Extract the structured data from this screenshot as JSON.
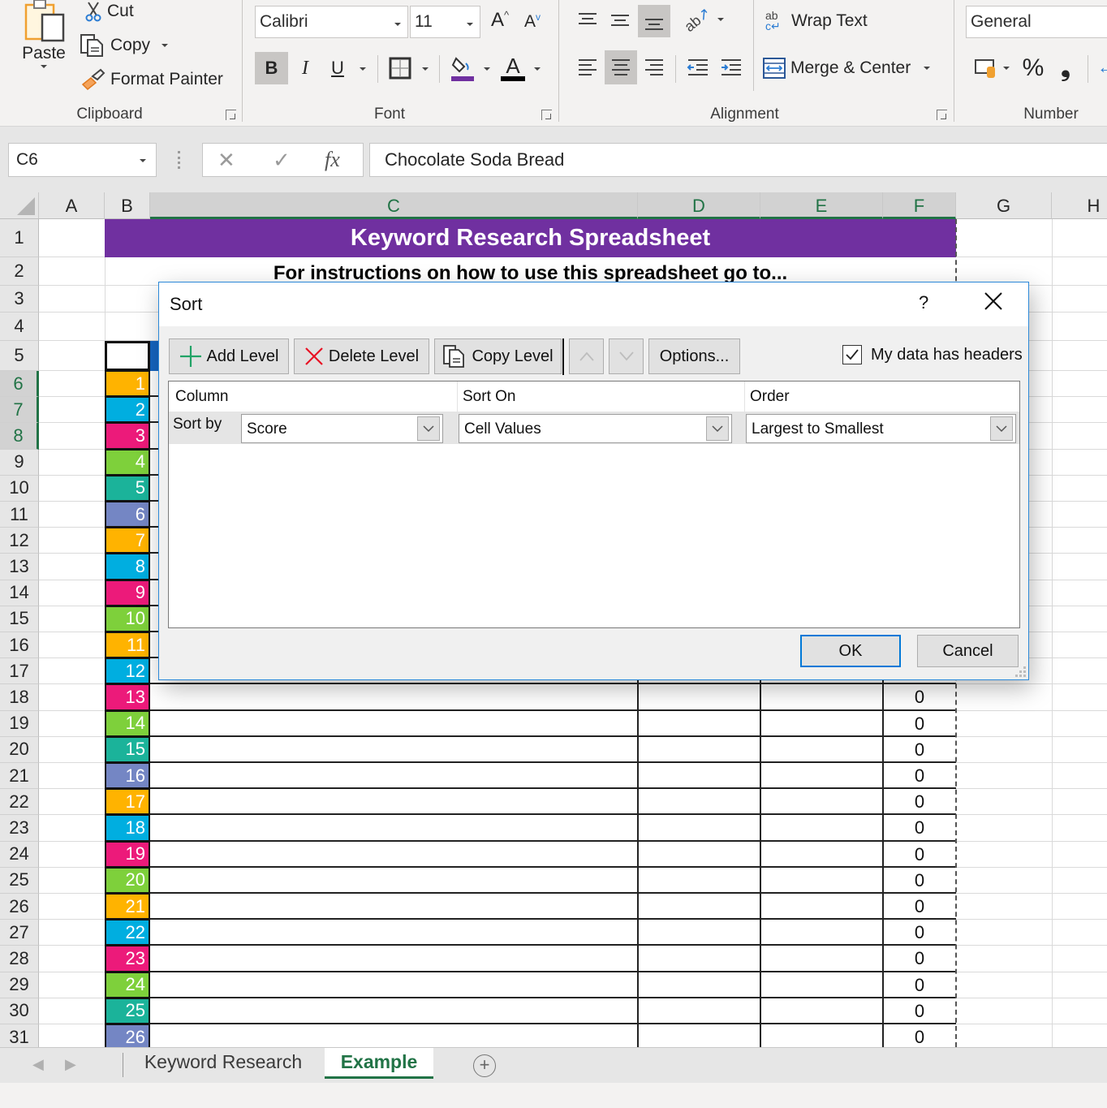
{
  "ribbon": {
    "clipboard": {
      "group_label": "Clipboard",
      "paste_label": "Paste",
      "cut_label": "Cut",
      "copy_label": "Copy",
      "format_painter_label": "Format Painter"
    },
    "font": {
      "group_label": "Font",
      "font_name": "Calibri",
      "font_size": "11",
      "bold_label": "B",
      "italic_label": "I",
      "underline_label": "U",
      "fill_color": "#7030a0",
      "font_color": "#000000"
    },
    "alignment": {
      "group_label": "Alignment",
      "wrap_text_label": "Wrap Text",
      "merge_center_label": "Merge & Center"
    },
    "number": {
      "group_label": "Number",
      "format": "General",
      "percent_label": "%",
      "comma_label": "9"
    }
  },
  "formula_bar": {
    "name_box": "C6",
    "fx_label": "fx",
    "formula": "Chocolate Soda Bread"
  },
  "sheet": {
    "columns": [
      "A",
      "B",
      "C",
      "D",
      "E",
      "F",
      "G",
      "H"
    ],
    "selected_column": "C",
    "rows": [
      "1",
      "2",
      "3",
      "4",
      "5",
      "6",
      "7",
      "8",
      "9",
      "10",
      "11",
      "12",
      "13",
      "14",
      "15",
      "16",
      "17",
      "18",
      "19",
      "20",
      "21",
      "22",
      "23",
      "24",
      "25",
      "26",
      "27",
      "28",
      "29",
      "30",
      "31"
    ],
    "selected_rows": [
      "6",
      "7",
      "8"
    ],
    "title": "Keyword Research Spreadsheet",
    "title_color": "#7030a0",
    "instructions": "For instructions on how to use this spreadsheet go to...",
    "numbered_cells": [
      {
        "n": "1",
        "color": "#ffb300"
      },
      {
        "n": "2",
        "color": "#00aee0"
      },
      {
        "n": "3",
        "color": "#ec1a7a"
      },
      {
        "n": "4",
        "color": "#7ed03b"
      },
      {
        "n": "5",
        "color": "#1bb39a"
      },
      {
        "n": "6",
        "color": "#7486c4"
      },
      {
        "n": "7",
        "color": "#ffb300"
      },
      {
        "n": "8",
        "color": "#00aee0"
      },
      {
        "n": "9",
        "color": "#ec1a7a"
      },
      {
        "n": "10",
        "color": "#7ed03b"
      },
      {
        "n": "11",
        "color": "#ffb300"
      },
      {
        "n": "12",
        "color": "#00aee0"
      },
      {
        "n": "13",
        "color": "#ec1a7a"
      },
      {
        "n": "14",
        "color": "#7ed03b"
      },
      {
        "n": "15",
        "color": "#1bb39a"
      },
      {
        "n": "16",
        "color": "#7486c4"
      },
      {
        "n": "17",
        "color": "#ffb300"
      },
      {
        "n": "18",
        "color": "#00aee0"
      },
      {
        "n": "19",
        "color": "#ec1a7a"
      },
      {
        "n": "20",
        "color": "#7ed03b"
      },
      {
        "n": "21",
        "color": "#ffb300"
      },
      {
        "n": "22",
        "color": "#00aee0"
      },
      {
        "n": "23",
        "color": "#ec1a7a"
      },
      {
        "n": "24",
        "color": "#7ed03b"
      },
      {
        "n": "25",
        "color": "#1bb39a"
      },
      {
        "n": "26",
        "color": "#7486c4"
      }
    ],
    "score_values_visible_rows_18_to_31": [
      "0",
      "0",
      "0",
      "0",
      "0",
      "0",
      "0",
      "0",
      "0",
      "0",
      "0",
      "0",
      "0",
      "0"
    ]
  },
  "tabs": {
    "sheets": [
      {
        "label": "Keyword Research",
        "active": false
      },
      {
        "label": "Example",
        "active": true
      }
    ],
    "add_sheet_label": "+"
  },
  "sort_dialog": {
    "title": "Sort",
    "help_label": "?",
    "add_level_label": "Add Level",
    "delete_level_label": "Delete Level",
    "copy_level_label": "Copy Level",
    "options_label": "Options...",
    "has_headers_label": "My data has headers",
    "has_headers_checked": true,
    "headers": {
      "column": "Column",
      "sort_on": "Sort On",
      "order": "Order"
    },
    "levels": [
      {
        "label": "Sort by",
        "column": "Score",
        "sort_on": "Cell Values",
        "order": "Largest to Smallest"
      }
    ],
    "ok_label": "OK",
    "cancel_label": "Cancel"
  }
}
